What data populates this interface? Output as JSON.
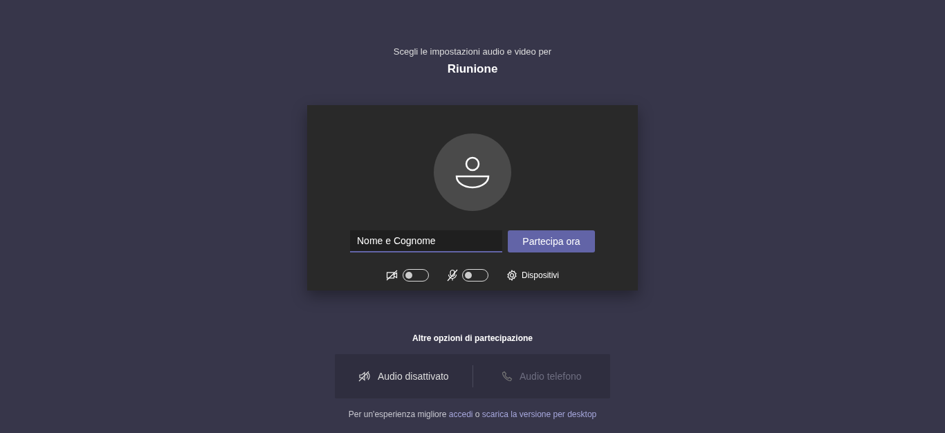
{
  "heading": {
    "subtitle": "Scegli le impostazioni audio e video per",
    "title": "Riunione"
  },
  "name_field": {
    "value": "Nome e Cognome"
  },
  "join_button": "Partecipa ora",
  "toggles": [
    {
      "kind": "camera",
      "on": false
    },
    {
      "kind": "microphone",
      "on": false
    }
  ],
  "devices_button": "Dispositivi",
  "other_options": {
    "title": "Altre opzioni di partecipazione",
    "options": [
      {
        "kind": "audio-off",
        "label": "Audio disattivato",
        "disabled": false
      },
      {
        "kind": "phone",
        "label": "Audio telefono",
        "disabled": true
      }
    ]
  },
  "footer": {
    "text": "Per un'esperienza migliore",
    "link_1": "accedi",
    "joiner": "o",
    "link_2": "scarica la versione per desktop"
  }
}
